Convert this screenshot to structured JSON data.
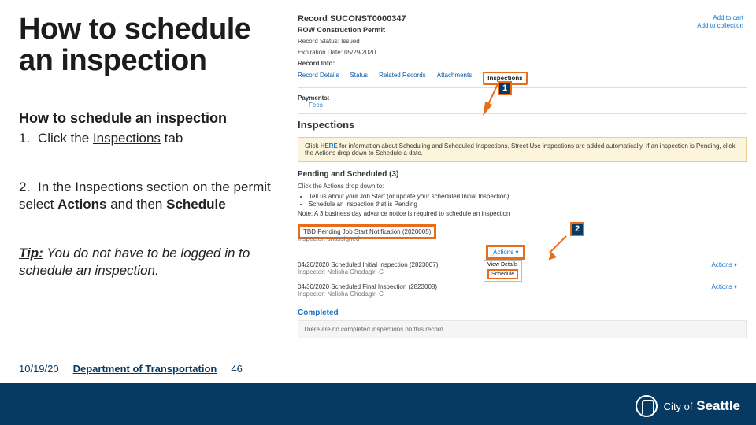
{
  "title_line1": "How to schedule",
  "title_line2": "an inspection",
  "subhead": "How to schedule an inspection",
  "step1": {
    "num": "1.",
    "pre": "Click the ",
    "u": "Inspections",
    "post": " tab"
  },
  "step2": {
    "num": "2.",
    "pre": "In the Inspections section on the permit select ",
    "b1": "Actions",
    "mid": " and then ",
    "b2": "Schedule"
  },
  "tip": {
    "label": "Tip:",
    "text": " You do not have to be logged in to schedule an inspection."
  },
  "shot": {
    "add_cart": "Add to cart",
    "add_coll": "Add to collection",
    "record_label": "Record",
    "record_id": "SUCONST0000347",
    "record_type": "ROW Construction Permit",
    "status": "Record Status: Issued",
    "expire": "Expiration Date: 05/29/2020",
    "info": "Record Info:",
    "tabs": {
      "details": "Record Details",
      "status": "Status",
      "related": "Related Records",
      "attach": "Attachments",
      "insp": "Inspections"
    },
    "payments": "Payments:",
    "fees": "Fees",
    "section_h": "Inspections",
    "yellow_pre": "Click ",
    "yellow_here": "HERE",
    "yellow_post": " for information about Scheduling and Scheduled Inspections. Street Use inspections are added automatically. If an inspection is Pending, click the Actions drop down to Schedule a date.",
    "pending_h": "Pending and Scheduled (3)",
    "actions_intro": "Click the Actions drop down to:",
    "bullets": [
      "Tell us about your Job Start (or update your scheduled Initial Inspection)",
      "Schedule an inspection that is Pending"
    ],
    "note": "Note: A 3 business day advance notice is required to schedule an inspection",
    "tbd": "TBD Pending Job Start Notification (2020005)",
    "insp_un": "Inspector: unassigned",
    "actions": "Actions ▾",
    "menu_view": "View Details",
    "menu_sched": "Schedule",
    "row2_t": "04/20/2020 Scheduled Initial Inspection (2823007)",
    "row2_i": "Inspector: Nelisha Chodagiri-C",
    "row3_t": "04/30/2020 Scheduled Final Inspection (2823008)",
    "row3_i": "Inspector: Nelisha Chodagiri-C",
    "completed": "Completed",
    "nocomp": "There are no completed inspections on this record."
  },
  "callouts": {
    "one": "1",
    "two": "2"
  },
  "footer": {
    "date": "10/19/20",
    "dept": "Department of Transportation",
    "page": "46",
    "logo_city": "City of",
    "logo_name": "Seattle"
  }
}
